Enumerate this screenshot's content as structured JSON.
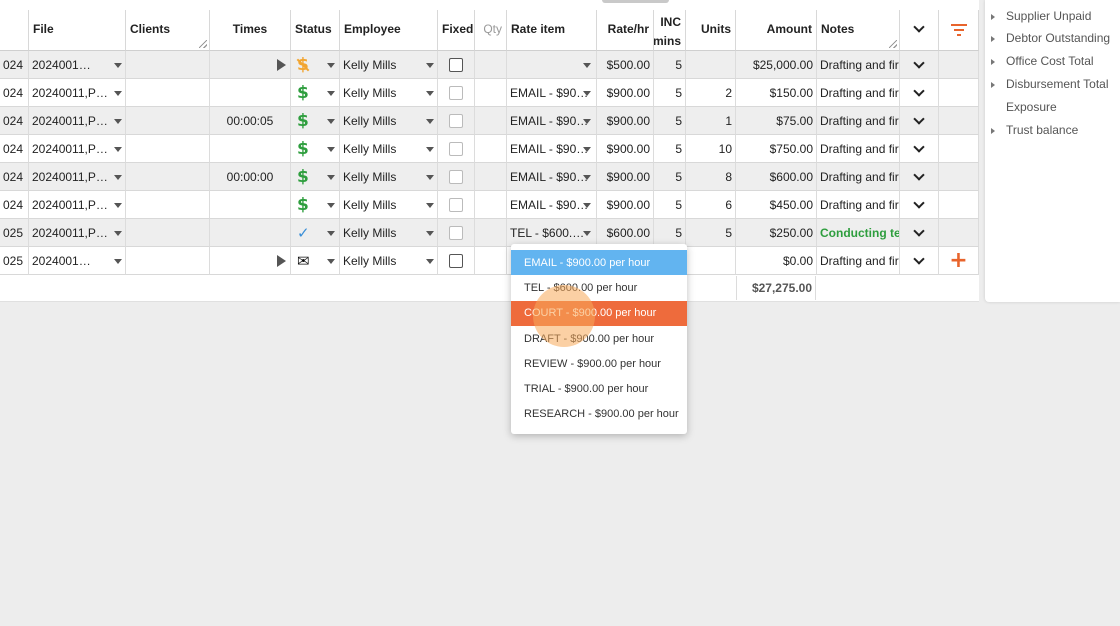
{
  "headers": {
    "file": "File",
    "clients": "Clients",
    "times": "Times",
    "status": "Status",
    "employee": "Employee",
    "fixed": "Fixed",
    "qty": "Qty",
    "rate_item": "Rate item",
    "rate_hr": "Rate/hr",
    "inc_line1": "INC",
    "inc_line2": "mins",
    "units": "Units",
    "amount": "Amount",
    "notes": "Notes"
  },
  "rows": [
    {
      "date": "024",
      "file": "2024001…",
      "clients": "",
      "times": "",
      "play": true,
      "status": "dollar-strike",
      "employee": "Kelly Mills",
      "fixed_active": true,
      "qty": "",
      "rate_item": "",
      "rate_hr": "$500.00",
      "inc": "5",
      "units": "",
      "amount": "$25,000.00",
      "notes": "Drafting and fir",
      "notes_green": false,
      "plus": false
    },
    {
      "date": "024",
      "file": "20240011,P…",
      "clients": "",
      "times": "",
      "play": false,
      "status": "dollar",
      "employee": "Kelly Mills",
      "fixed_active": false,
      "qty": "",
      "rate_item": "EMAIL - $90…",
      "rate_hr": "$900.00",
      "inc": "5",
      "units": "2",
      "amount": "$150.00",
      "notes": "Drafting and fir",
      "notes_green": false,
      "plus": false
    },
    {
      "date": "024",
      "file": "20240011,P…",
      "clients": "",
      "times": "00:00:05",
      "play": false,
      "status": "dollar",
      "employee": "Kelly Mills",
      "fixed_active": false,
      "qty": "",
      "rate_item": "EMAIL - $90…",
      "rate_hr": "$900.00",
      "inc": "5",
      "units": "1",
      "amount": "$75.00",
      "notes": "Drafting and fir",
      "notes_green": false,
      "plus": false
    },
    {
      "date": "024",
      "file": "20240011,P…",
      "clients": "",
      "times": "",
      "play": false,
      "status": "dollar",
      "employee": "Kelly Mills",
      "fixed_active": false,
      "qty": "",
      "rate_item": "EMAIL - $90…",
      "rate_hr": "$900.00",
      "inc": "5",
      "units": "10",
      "amount": "$750.00",
      "notes": "Drafting and fir",
      "notes_green": false,
      "plus": false
    },
    {
      "date": "024",
      "file": "20240011,P…",
      "clients": "",
      "times": "00:00:00",
      "play": false,
      "status": "dollar",
      "employee": "Kelly Mills",
      "fixed_active": false,
      "qty": "",
      "rate_item": "EMAIL - $90…",
      "rate_hr": "$900.00",
      "inc": "5",
      "units": "8",
      "amount": "$600.00",
      "notes": "Drafting and fir",
      "notes_green": false,
      "plus": false
    },
    {
      "date": "024",
      "file": "20240011,P…",
      "clients": "",
      "times": "",
      "play": false,
      "status": "dollar",
      "employee": "Kelly Mills",
      "fixed_active": false,
      "qty": "",
      "rate_item": "EMAIL - $90…",
      "rate_hr": "$900.00",
      "inc": "5",
      "units": "6",
      "amount": "$450.00",
      "notes": "Drafting and fir",
      "notes_green": false,
      "plus": false
    },
    {
      "date": "025",
      "file": "20240011,P…",
      "clients": "",
      "times": "",
      "play": false,
      "status": "check",
      "employee": "Kelly Mills",
      "fixed_active": false,
      "qty": "",
      "rate_item": "TEL - $600.…",
      "rate_hr": "$600.00",
      "inc": "5",
      "units": "5",
      "amount": "$250.00",
      "notes": "Conducting tel",
      "notes_green": true,
      "plus": false
    },
    {
      "date": "025",
      "file": "2024001…",
      "clients": "",
      "times": "",
      "play": true,
      "status": "envelope",
      "employee": "Kelly Mills",
      "fixed_active": true,
      "qty": "",
      "rate_item": "",
      "rate_hr": "",
      "inc": "",
      "units": "",
      "amount": "$0.00",
      "notes": "Drafting and fir",
      "notes_green": false,
      "plus": true
    }
  ],
  "total_amount": "$27,275.00",
  "side_panel": {
    "items": [
      "Supplier Unpaid",
      "Debtor Outstanding",
      "Office Cost Total",
      "Disbursement Total",
      "Exposure",
      "Trust balance"
    ]
  },
  "dropdown": {
    "options": [
      "EMAIL - $900.00 per hour",
      "TEL - $600.00 per hour",
      "COURT - $900.00 per hour",
      "DRAFT - $900.00 per hour",
      "REVIEW - $900.00 per hour",
      "TRIAL - $900.00 per hour",
      "RESEARCH - $900.00 per hour"
    ],
    "selected_index": 0,
    "hover_index": 2
  },
  "colors": {
    "accent_orange": "#e8642c",
    "status_green": "#2e9e3e",
    "selected_blue": "#62b4f0"
  }
}
